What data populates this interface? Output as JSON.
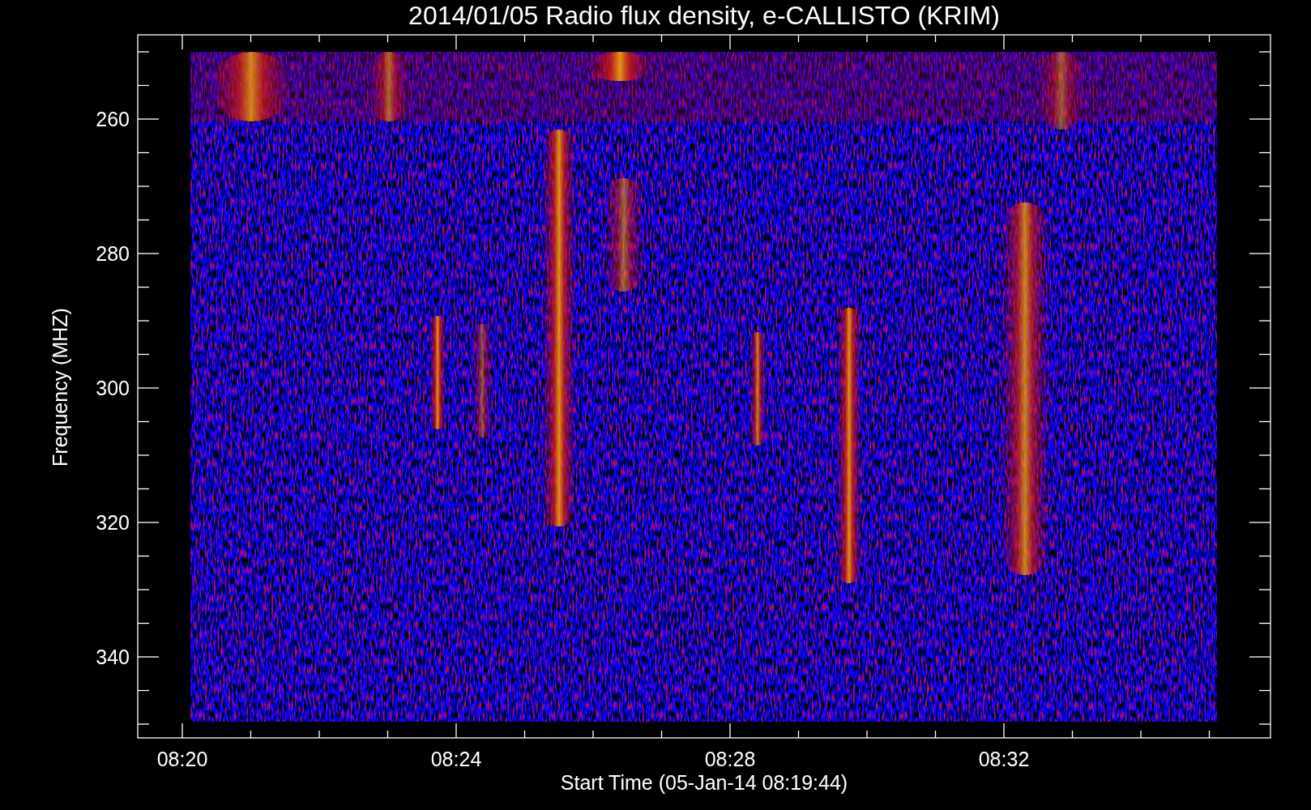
{
  "title": "2014/01/05  Radio flux density, e-CALLISTO (KRIM)",
  "y_axis": {
    "label": "Frequency (MHZ)",
    "ticks": [
      "260",
      "280",
      "300",
      "320",
      "340"
    ]
  },
  "x_axis": {
    "label": "Start Time (05-Jan-14 08:19:44)",
    "ticks": [
      "08:20",
      "08:24",
      "08:28",
      "08:32"
    ]
  }
}
